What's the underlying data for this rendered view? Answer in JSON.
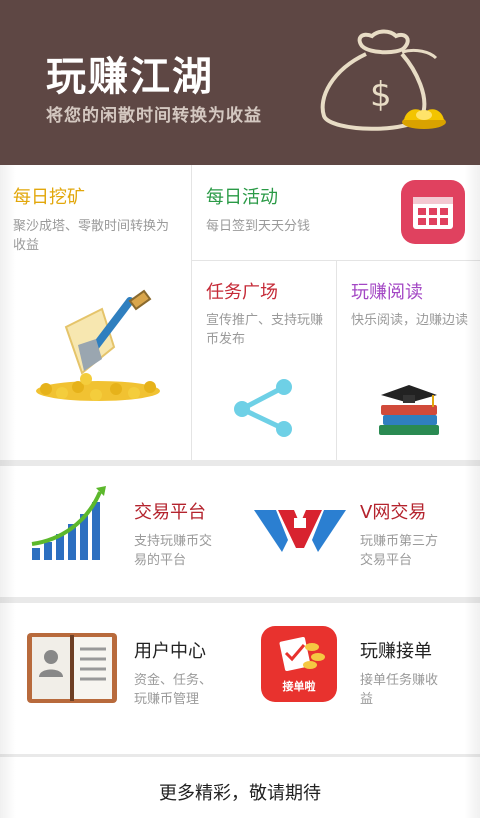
{
  "banner": {
    "title": "玩赚江湖",
    "subtitle": "将您的闲散时间转换为收益"
  },
  "tiles": {
    "mining": {
      "title": "每日挖矿",
      "desc": "聚沙成塔、零散时间转换为收益",
      "icon": "shovel-gold-coins-icon"
    },
    "activity": {
      "title": "每日活动",
      "desc": "每日签到天天分钱",
      "icon": "calendar-icon"
    },
    "task": {
      "title": "任务广场",
      "desc": "宣传推广、支持玩赚币发布",
      "icon": "share-icon"
    },
    "reading": {
      "title": "玩赚阅读",
      "desc": "快乐阅读，边赚边读",
      "icon": "books-icon"
    },
    "trade": {
      "title": "交易平台",
      "desc": "支持玩赚币交易的平台",
      "icon": "growth-chart-icon"
    },
    "vnet": {
      "title": "V网交易",
      "desc": "玩赚币第三方交易平台",
      "icon": "vnet-logo-icon"
    },
    "user": {
      "title": "用户中心",
      "desc": "资金、任务、玩赚币管理",
      "icon": "address-book-icon"
    },
    "order": {
      "title": "玩赚接单",
      "desc": "接单任务赚收益",
      "icon": "order-app-icon",
      "icon_text": "接单啦"
    }
  },
  "footer": {
    "text": "更多精彩，敬请期待"
  },
  "colors": {
    "banner": "#5e4744",
    "mining": "#e2a70b",
    "activity": "#2a9a46",
    "task": "#c52a37",
    "reading": "#a347c4",
    "trade": "#b4232d",
    "vnet": "#b4232d",
    "user": "#222222",
    "order": "#222222"
  }
}
